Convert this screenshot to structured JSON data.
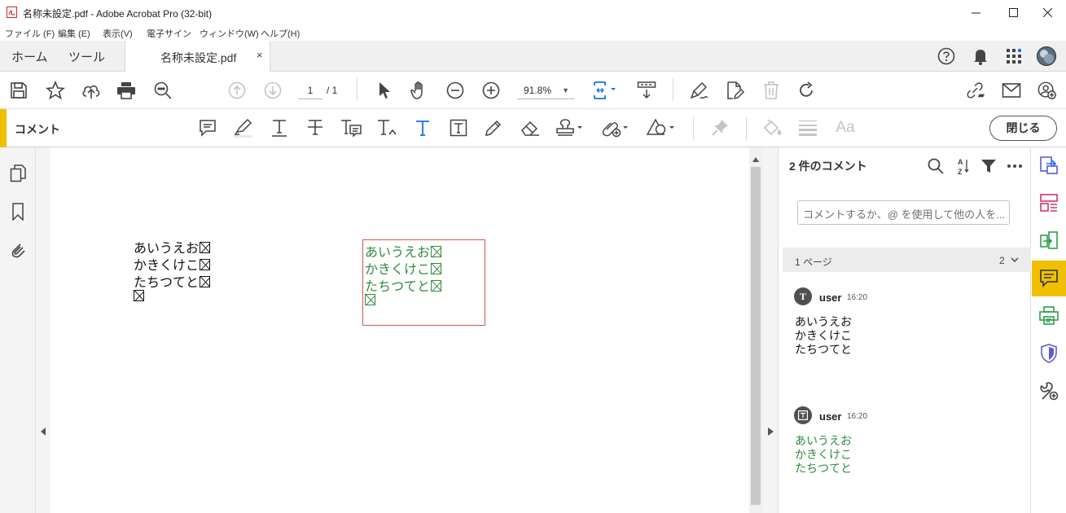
{
  "window": {
    "title": "名称未設定.pdf - Adobe Acrobat Pro (32-bit)"
  },
  "menu": [
    "ファイル (F)",
    "編集 (E)",
    "表示(V)",
    "電子サイン",
    "ウィンドウ(W)",
    "ヘルプ(H)"
  ],
  "tabs": {
    "home": "ホーム",
    "tools": "ツール",
    "document": "名称未設定.pdf",
    "close_glyph": "×"
  },
  "toolbar": {
    "page_current": "1",
    "page_total": "/ 1",
    "zoom": "91.8%"
  },
  "comment_toolbar": {
    "title": "コメント",
    "close_label": "閉じる",
    "font_label": "Aa"
  },
  "document": {
    "plain_text": [
      "あいうえお",
      "かきくけこ",
      "たちつてと",
      ""
    ],
    "annotation_text": [
      "あいうえお",
      "かきくけこ",
      "たちつてと",
      ""
    ],
    "annotation_color": "#2e8b3e",
    "annotation_border_color": "#d9534f"
  },
  "comments_pane": {
    "count_label": "2 件のコメント",
    "input_placeholder": "コメントするか、@ を使用して他の人を...",
    "page_label": "1 ページ",
    "page_count": "2",
    "entries": [
      {
        "type_icon": "text-comment-icon",
        "avatar_glyph": "T",
        "user": "user",
        "time": "16:20",
        "body": "あいうえお\nかきくけこ\nたちつてと",
        "color": "#111111"
      },
      {
        "type_icon": "textbox-comment-icon",
        "avatar_glyph": "T",
        "user": "user",
        "time": "16:20",
        "body": "あいうえお\nかきくけこ\nたちつてと",
        "color": "#2e8b3e"
      }
    ]
  },
  "colors": {
    "accent": "#f0c000",
    "blue": "#1473e6"
  }
}
